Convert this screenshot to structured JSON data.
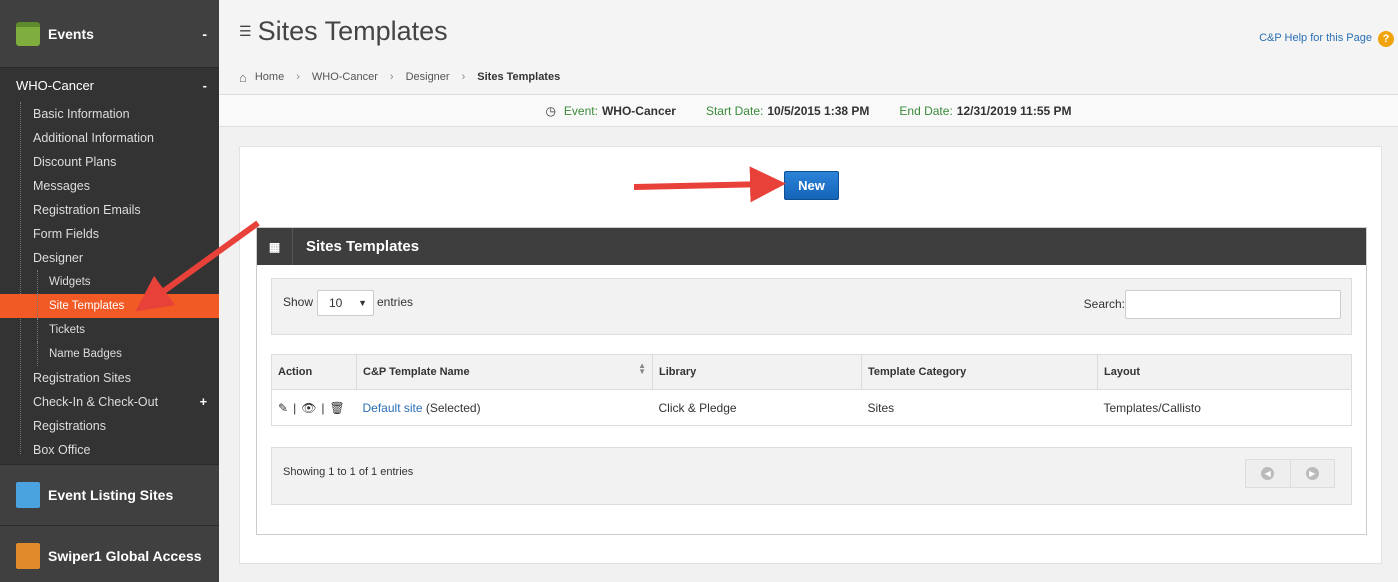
{
  "sidebar": {
    "events_label": "Events",
    "events_toggle": "-",
    "event_name": "WHO-Cancer",
    "event_toggle": "-",
    "items": [
      {
        "label": "Basic Information"
      },
      {
        "label": "Additional Information"
      },
      {
        "label": "Discount Plans"
      },
      {
        "label": "Messages"
      },
      {
        "label": "Registration Emails"
      },
      {
        "label": "Form Fields"
      },
      {
        "label": "Designer"
      },
      {
        "label": "Widgets"
      },
      {
        "label": "Site Templates"
      },
      {
        "label": "Tickets"
      },
      {
        "label": "Name Badges"
      },
      {
        "label": "Registration Sites"
      },
      {
        "label": "Check-In & Check-Out",
        "toggle": "+"
      },
      {
        "label": "Registrations"
      },
      {
        "label": "Box Office"
      }
    ],
    "event_listing_label": "Event Listing Sites",
    "swiper_label": "Swiper1 Global Access"
  },
  "header": {
    "title": "Sites Templates",
    "help_link": "C&P Help for this Page",
    "help_icon": "?"
  },
  "breadcrumb": {
    "items": [
      "Home",
      "WHO-Cancer",
      "Designer"
    ],
    "current": "Sites Templates"
  },
  "event_bar": {
    "event_label": "Event:",
    "event_value": "WHO-Cancer",
    "start_label": "Start Date:",
    "start_value": "10/5/2015 1:38 PM",
    "end_label": "End Date:",
    "end_value": "12/31/2019 11:55 PM"
  },
  "toolbar": {
    "new_label": "New"
  },
  "widget": {
    "title": "Sites Templates",
    "show_label": "Show",
    "entries_value": "10",
    "entries_label": "entries",
    "search_label": "Search:",
    "columns": [
      "Action",
      "C&P Template Name",
      "Library",
      "Template Category",
      "Layout"
    ],
    "rows": [
      {
        "name": "Default site",
        "name_suffix": "(Selected)",
        "library": "Click & Pledge",
        "category": "Sites",
        "layout": "Templates/Callisto"
      }
    ],
    "footer_info": "Showing 1 to 1 of 1 entries"
  },
  "colors": {
    "active": "#f15a24",
    "primary_button": "#1a6fc8",
    "arrow": "#e8413a"
  }
}
